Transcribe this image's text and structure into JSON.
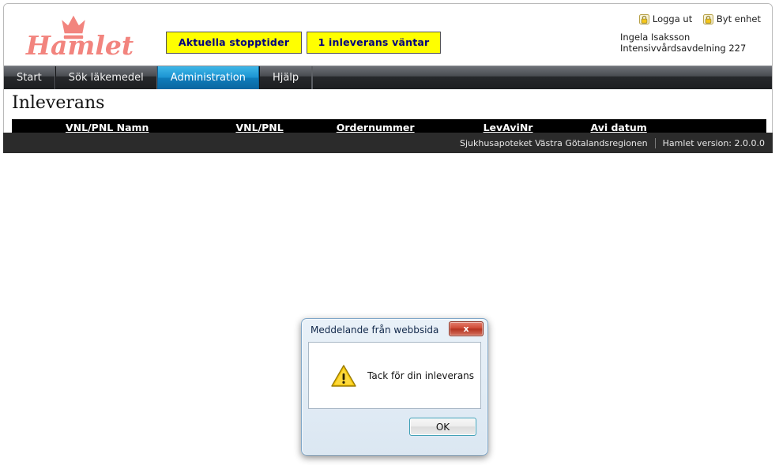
{
  "brand": {
    "logo_text": "Hamlet",
    "logo_color": "#f2847e"
  },
  "header": {
    "quick_buttons": [
      {
        "label": "Aktuella stopptider",
        "name": "aktuella-stopptider-button"
      },
      {
        "label": "1 inleverans väntar",
        "name": "inleverans-vantar-button"
      }
    ],
    "account_links": [
      {
        "label": "Logga ut",
        "icon": "lock-icon"
      },
      {
        "label": "Byt enhet",
        "icon": "lock-icon"
      }
    ],
    "user_name": "Ingela Isaksson",
    "user_department": "Intensivvårdsavdelning 227"
  },
  "nav": {
    "items": [
      {
        "label": "Start",
        "active": false
      },
      {
        "label": "Sök läkemedel",
        "active": false
      },
      {
        "label": "Administration",
        "active": true
      },
      {
        "label": "Hjälp",
        "active": false
      }
    ],
    "active_color": "#1c94d2"
  },
  "main": {
    "page_title": "Inleverans",
    "table": {
      "columns": [
        "VNL/PNL Namn",
        "VNL/PNL",
        "Ordernummer",
        "LevAviNr",
        "Avi datum"
      ],
      "rows": []
    }
  },
  "footer": {
    "organization": "Sjukhusapoteket Västra Götalandsregionen",
    "version": "Hamlet version: 2.0.0.0"
  },
  "dialog": {
    "title": "Meddelande från webbsida",
    "close_label": "x",
    "icon": "warning-icon",
    "message": "Tack för din inleverans",
    "ok_label": "OK"
  }
}
